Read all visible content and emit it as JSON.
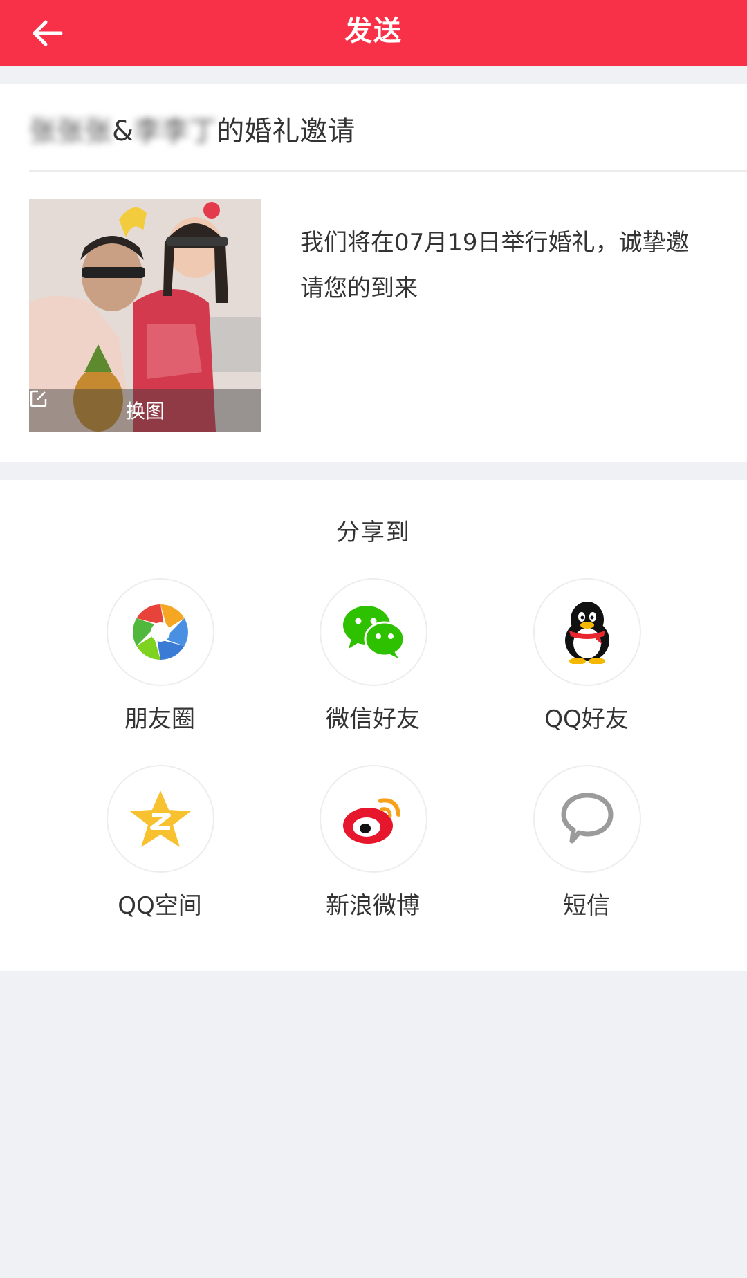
{
  "header": {
    "title": "发送",
    "back_icon": "arrow-left-icon",
    "background": "#f83148"
  },
  "invitation": {
    "name_1": "张张张",
    "ampersand": "&",
    "name_2": "李李丁",
    "title_suffix": "的婚礼邀请",
    "change_image_label": "换图",
    "description": "我们将在07月19日举行婚礼，诚挚邀请您的到来"
  },
  "share": {
    "title": "分享到",
    "items": [
      {
        "label": "朋友圈",
        "icon": "moments-icon"
      },
      {
        "label": "微信好友",
        "icon": "wechat-icon"
      },
      {
        "label": "QQ好友",
        "icon": "qq-icon"
      },
      {
        "label": "QQ空间",
        "icon": "qzone-icon"
      },
      {
        "label": "新浪微博",
        "icon": "weibo-icon"
      },
      {
        "label": "短信",
        "icon": "sms-icon"
      }
    ]
  }
}
